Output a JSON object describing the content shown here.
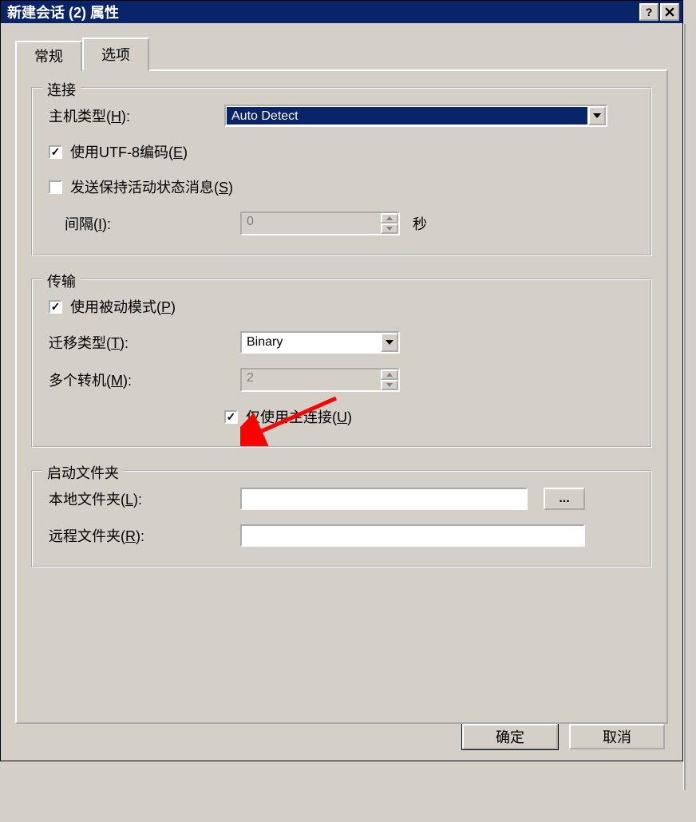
{
  "title": "新建会话 (2) 属性",
  "tabs": {
    "general": "常规",
    "options": "选项"
  },
  "groups": {
    "connect": {
      "legend": "连接",
      "host_type_label": "主机类型(",
      "host_type_key": "H",
      "host_type_suffix": "):",
      "host_type_value": "Auto Detect",
      "utf8_label_a": "使用UTF-8编码(",
      "utf8_key": "E",
      "utf8_suffix": ")",
      "keepalive_label_a": "发送保持活动状态消息(",
      "keepalive_key": "S",
      "keepalive_suffix": ")",
      "interval_label_a": "间隔(",
      "interval_key": "I",
      "interval_suffix": "):",
      "interval_value": "0",
      "interval_unit": "秒"
    },
    "transfer": {
      "legend": "传输",
      "passive_label_a": "使用被动模式(",
      "passive_key": "P",
      "passive_suffix": ")",
      "xfer_type_label_a": "迁移类型(",
      "xfer_type_key": "T",
      "xfer_type_suffix": "):",
      "xfer_type_value": "Binary",
      "multi_label_a": "多个转机(",
      "multi_key": "M",
      "multi_suffix": "):",
      "multi_value": "2",
      "primary_label_a": "仅使用主连接(",
      "primary_key": "U",
      "primary_suffix": ")"
    },
    "startup": {
      "legend": "启动文件夹",
      "local_label_a": "本地文件夹(",
      "local_key": "L",
      "local_suffix": "):",
      "remote_label_a": "远程文件夹(",
      "remote_key": "R",
      "remote_suffix": "):",
      "browse": "..."
    }
  },
  "buttons": {
    "ok": "确定",
    "cancel": "取消"
  }
}
